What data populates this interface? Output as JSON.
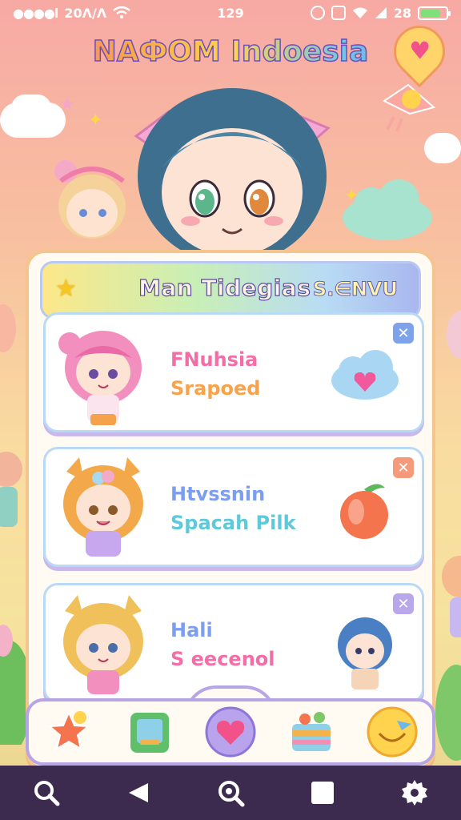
{
  "status_bar": {
    "signal": "●●●●l",
    "time_left": "20Λ/Λ",
    "time_center": "129",
    "battery_label": "28",
    "battery_level": 0.8
  },
  "app_title": "NAФOM Indoesia",
  "panel": {
    "title": "Man Tidegias",
    "menu_label": "S.∈NVU"
  },
  "cards": [
    {
      "line1": "FNuhsia",
      "line2": "Srapoed",
      "line1_color": "#f36da6",
      "line2_color": "#f8a24c",
      "close_color": "#7ea3ea",
      "sticker": "heart-cloud-icon"
    },
    {
      "line1": "Htvssnin",
      "line2": "Spacah Pilk",
      "line1_color": "#7c9ef0",
      "line2_color": "#5ec9d8",
      "close_color": "#f59a7a",
      "sticker": "peach-icon"
    },
    {
      "line1": "Hali",
      "line2": "S eecenol",
      "line1_color": "#7c9ef0",
      "line2_color": "#f36da6",
      "close_color": "#b8a7ea",
      "sticker": "blue-hair-character"
    }
  ],
  "dock": {
    "items": [
      "star-badge-icon",
      "tablet-icon",
      "heart-icon",
      "cake-icon",
      "smiley-icon"
    ]
  },
  "navbar": {
    "items": [
      "search-icon",
      "back-icon",
      "zoom-icon",
      "square-icon",
      "gear-icon"
    ]
  },
  "colors": {
    "accent_pink": "#f36da6",
    "accent_purple": "#b7a5e6",
    "navbar": "#3c2a4f"
  }
}
